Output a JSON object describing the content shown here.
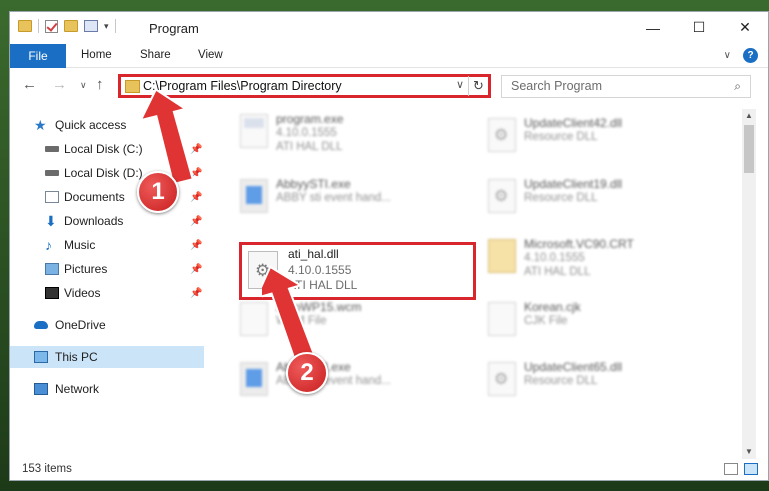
{
  "window": {
    "title": "Program",
    "minimize": "—",
    "maximize": "☐",
    "close": "✕"
  },
  "ribbon": {
    "file": "File",
    "home": "Home",
    "share": "Share",
    "view": "View",
    "help": "?"
  },
  "address": {
    "path": "C:\\Program Files\\Program Directory",
    "search_placeholder": "Search Program"
  },
  "sidebar": {
    "quick_access": "Quick access",
    "local_c": "Local Disk (C:)",
    "local_d": "Local Disk (D:)",
    "documents": "Documents",
    "downloads": "Downloads",
    "music": "Music",
    "pictures": "Pictures",
    "videos": "Videos",
    "onedrive": "OneDrive",
    "this_pc": "This PC",
    "network": "Network"
  },
  "files": [
    {
      "name": "program.exe",
      "line1": "4.10.0.1555",
      "line2": "ATI HAL DLL"
    },
    {
      "name": "UpdateClient42.dll",
      "line1": "Resource DLL",
      "line2": ""
    },
    {
      "name": "AbbyySTI.exe",
      "line1": "ABBY sti event hand...",
      "line2": ""
    },
    {
      "name": "UpdateClient19.dll",
      "line1": "Resource DLL",
      "line2": ""
    },
    {
      "name": "ati_hal.dll",
      "line1": "4.10.0.1555",
      "line2": "ATI HAL DLL"
    },
    {
      "name": "Microsoft.VC90.CRT",
      "line1": "4.10.0.1555",
      "line2": "ATI HAL DLL"
    },
    {
      "name": "AutoWP15.wcm",
      "line1": "WCM File",
      "line2": ""
    },
    {
      "name": "Korean.cjk",
      "line1": "CJK File",
      "line2": ""
    },
    {
      "name": "AbbyySTI.exe",
      "line1": "ABBY sti event hand...",
      "line2": ""
    },
    {
      "name": "UpdateClient65.dll",
      "line1": "Resource DLL",
      "line2": ""
    }
  ],
  "status": {
    "count": "153 items"
  },
  "badges": {
    "one": "1",
    "two": "2"
  },
  "colors": {
    "accent": "#1a6fc4",
    "highlight_red": "#d9262c",
    "selected_bg": "#cce4f7"
  }
}
